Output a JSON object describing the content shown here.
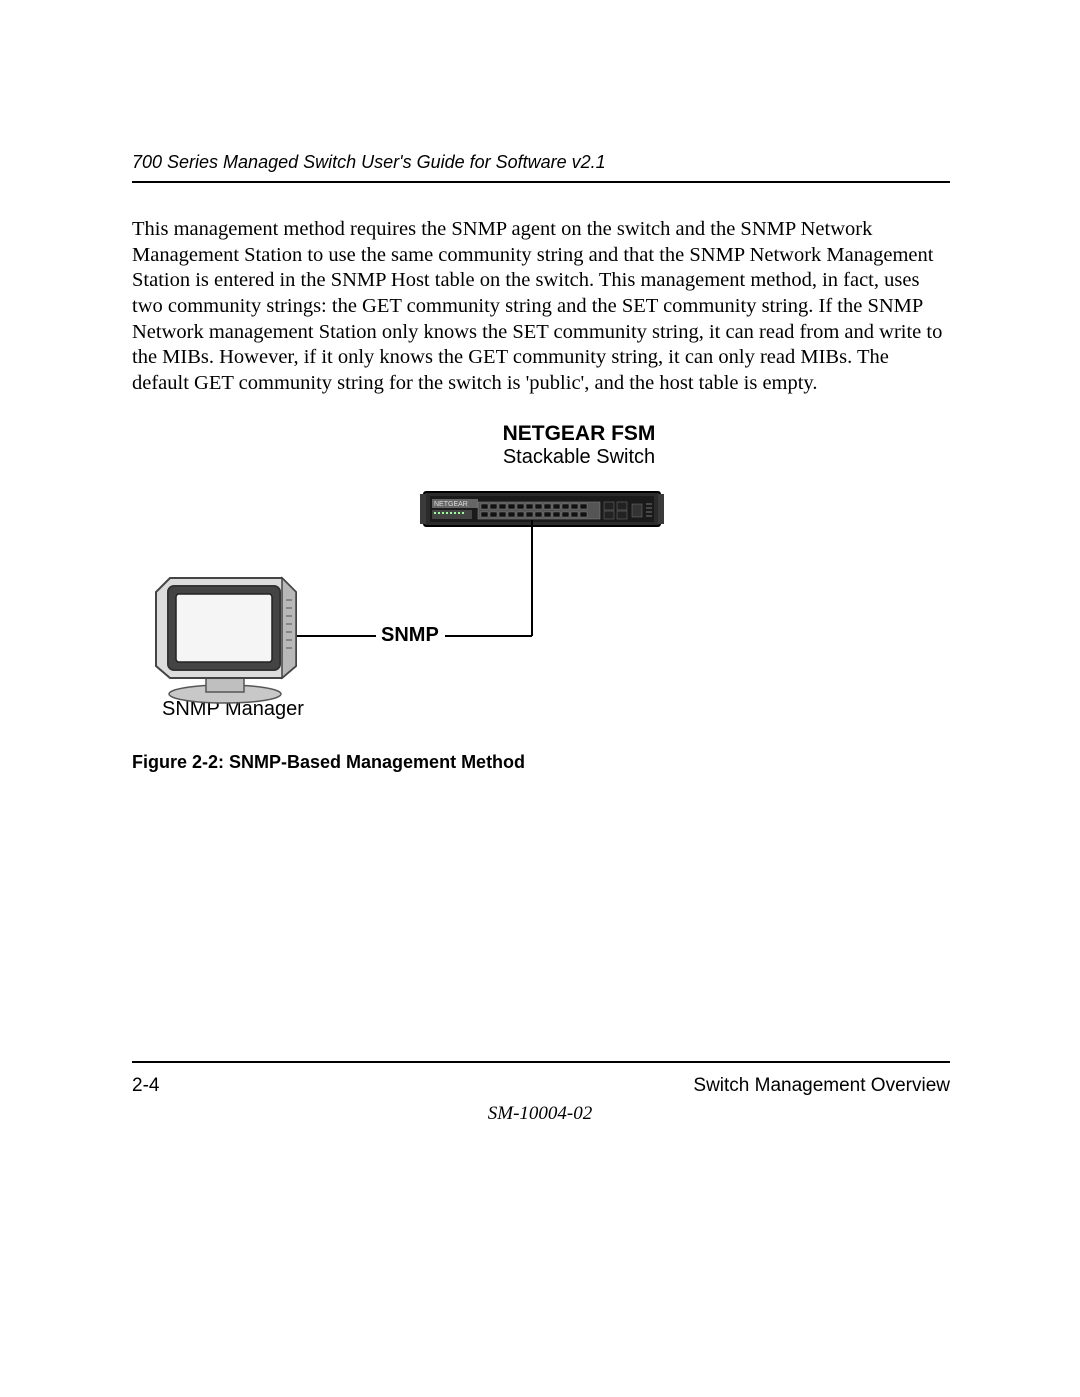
{
  "header": {
    "running_title": "700 Series Managed Switch User's Guide for Software v2.1"
  },
  "body": {
    "paragraph": "This management method requires the SNMP agent on the switch and the SNMP Network Management Station to use the same community string and that the SNMP Network Management Station is entered in the SNMP Host table on the switch. This management method, in fact, uses two community strings: the GET community string and the SET community string. If the SNMP Network management Station only knows the SET community string, it can read from and write to the MIBs. However, if it only knows the GET community string, it can only read MIBs. The default GET community string for the switch is 'public', and the host table is empty."
  },
  "figure": {
    "label_switch_line1": "NETGEAR FSM",
    "label_switch_line2": "Stackable Switch",
    "label_link": "SNMP",
    "label_manager": "SNMP Manager",
    "label_netgear_logo": "NETGEAR",
    "caption": "Figure 2-2:  SNMP-Based Management Method"
  },
  "footer": {
    "page_number": "2-4",
    "section_title": "Switch Management Overview",
    "doc_id": "SM-10004-02"
  }
}
